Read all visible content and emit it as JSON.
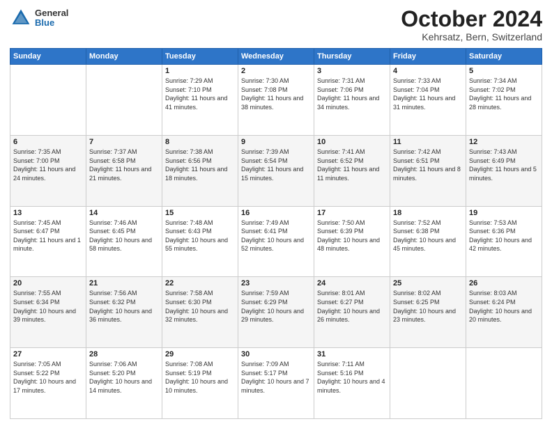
{
  "header": {
    "logo_general": "General",
    "logo_blue": "Blue",
    "title": "October 2024",
    "location": "Kehrsatz, Bern, Switzerland"
  },
  "days_of_week": [
    "Sunday",
    "Monday",
    "Tuesday",
    "Wednesday",
    "Thursday",
    "Friday",
    "Saturday"
  ],
  "weeks": [
    [
      null,
      null,
      {
        "day": 1,
        "sunrise": "7:29 AM",
        "sunset": "7:10 PM",
        "daylight": "11 hours and 41 minutes."
      },
      {
        "day": 2,
        "sunrise": "7:30 AM",
        "sunset": "7:08 PM",
        "daylight": "11 hours and 38 minutes."
      },
      {
        "day": 3,
        "sunrise": "7:31 AM",
        "sunset": "7:06 PM",
        "daylight": "11 hours and 34 minutes."
      },
      {
        "day": 4,
        "sunrise": "7:33 AM",
        "sunset": "7:04 PM",
        "daylight": "11 hours and 31 minutes."
      },
      {
        "day": 5,
        "sunrise": "7:34 AM",
        "sunset": "7:02 PM",
        "daylight": "11 hours and 28 minutes."
      }
    ],
    [
      {
        "day": 6,
        "sunrise": "7:35 AM",
        "sunset": "7:00 PM",
        "daylight": "11 hours and 24 minutes."
      },
      {
        "day": 7,
        "sunrise": "7:37 AM",
        "sunset": "6:58 PM",
        "daylight": "11 hours and 21 minutes."
      },
      {
        "day": 8,
        "sunrise": "7:38 AM",
        "sunset": "6:56 PM",
        "daylight": "11 hours and 18 minutes."
      },
      {
        "day": 9,
        "sunrise": "7:39 AM",
        "sunset": "6:54 PM",
        "daylight": "11 hours and 15 minutes."
      },
      {
        "day": 10,
        "sunrise": "7:41 AM",
        "sunset": "6:52 PM",
        "daylight": "11 hours and 11 minutes."
      },
      {
        "day": 11,
        "sunrise": "7:42 AM",
        "sunset": "6:51 PM",
        "daylight": "11 hours and 8 minutes."
      },
      {
        "day": 12,
        "sunrise": "7:43 AM",
        "sunset": "6:49 PM",
        "daylight": "11 hours and 5 minutes."
      }
    ],
    [
      {
        "day": 13,
        "sunrise": "7:45 AM",
        "sunset": "6:47 PM",
        "daylight": "11 hours and 1 minute."
      },
      {
        "day": 14,
        "sunrise": "7:46 AM",
        "sunset": "6:45 PM",
        "daylight": "10 hours and 58 minutes."
      },
      {
        "day": 15,
        "sunrise": "7:48 AM",
        "sunset": "6:43 PM",
        "daylight": "10 hours and 55 minutes."
      },
      {
        "day": 16,
        "sunrise": "7:49 AM",
        "sunset": "6:41 PM",
        "daylight": "10 hours and 52 minutes."
      },
      {
        "day": 17,
        "sunrise": "7:50 AM",
        "sunset": "6:39 PM",
        "daylight": "10 hours and 48 minutes."
      },
      {
        "day": 18,
        "sunrise": "7:52 AM",
        "sunset": "6:38 PM",
        "daylight": "10 hours and 45 minutes."
      },
      {
        "day": 19,
        "sunrise": "7:53 AM",
        "sunset": "6:36 PM",
        "daylight": "10 hours and 42 minutes."
      }
    ],
    [
      {
        "day": 20,
        "sunrise": "7:55 AM",
        "sunset": "6:34 PM",
        "daylight": "10 hours and 39 minutes."
      },
      {
        "day": 21,
        "sunrise": "7:56 AM",
        "sunset": "6:32 PM",
        "daylight": "10 hours and 36 minutes."
      },
      {
        "day": 22,
        "sunrise": "7:58 AM",
        "sunset": "6:30 PM",
        "daylight": "10 hours and 32 minutes."
      },
      {
        "day": 23,
        "sunrise": "7:59 AM",
        "sunset": "6:29 PM",
        "daylight": "10 hours and 29 minutes."
      },
      {
        "day": 24,
        "sunrise": "8:01 AM",
        "sunset": "6:27 PM",
        "daylight": "10 hours and 26 minutes."
      },
      {
        "day": 25,
        "sunrise": "8:02 AM",
        "sunset": "6:25 PM",
        "daylight": "10 hours and 23 minutes."
      },
      {
        "day": 26,
        "sunrise": "8:03 AM",
        "sunset": "6:24 PM",
        "daylight": "10 hours and 20 minutes."
      }
    ],
    [
      {
        "day": 27,
        "sunrise": "7:05 AM",
        "sunset": "5:22 PM",
        "daylight": "10 hours and 17 minutes."
      },
      {
        "day": 28,
        "sunrise": "7:06 AM",
        "sunset": "5:20 PM",
        "daylight": "10 hours and 14 minutes."
      },
      {
        "day": 29,
        "sunrise": "7:08 AM",
        "sunset": "5:19 PM",
        "daylight": "10 hours and 10 minutes."
      },
      {
        "day": 30,
        "sunrise": "7:09 AM",
        "sunset": "5:17 PM",
        "daylight": "10 hours and 7 minutes."
      },
      {
        "day": 31,
        "sunrise": "7:11 AM",
        "sunset": "5:16 PM",
        "daylight": "10 hours and 4 minutes."
      },
      null,
      null
    ]
  ]
}
